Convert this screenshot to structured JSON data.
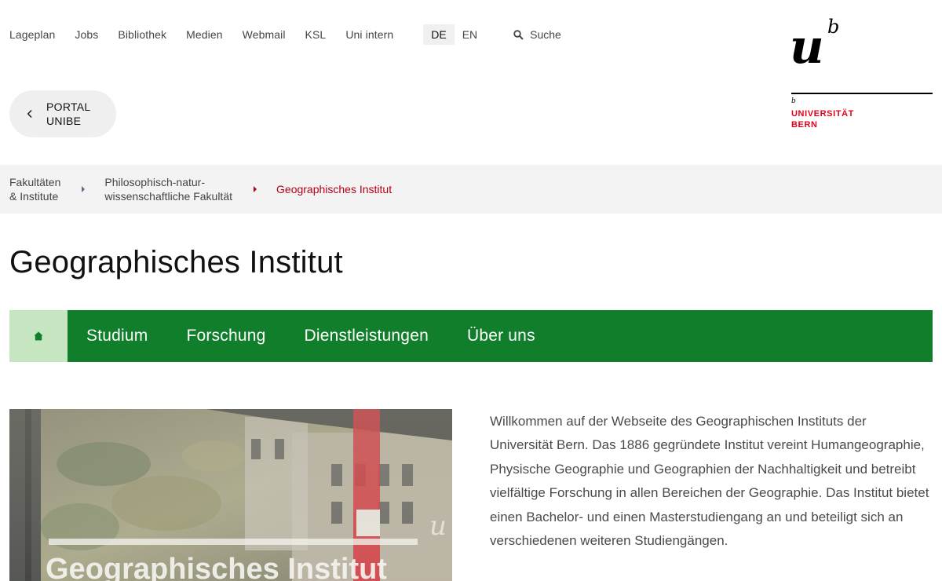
{
  "top_nav": {
    "links": [
      "Lageplan",
      "Jobs",
      "Bibliothek",
      "Medien",
      "Webmail",
      "KSL",
      "Uni intern"
    ],
    "languages": [
      "DE",
      "EN"
    ],
    "active_language": "DE",
    "search_label": "Suche"
  },
  "logo": {
    "mark_u": "u",
    "mark_b": "b",
    "small_b": "b",
    "line1": "UNIVERSITÄT",
    "line2": "BERN",
    "color": "#e2001a"
  },
  "portal_button": {
    "line1": "PORTAL",
    "line2": "UNIBE"
  },
  "breadcrumb": {
    "items": [
      {
        "line1": "Fakultäten",
        "line2": "& Institute"
      },
      {
        "line1": "Philosophisch-natur-",
        "line2": "wissenschaftliche Fakultät"
      }
    ],
    "current": "Geographisches Institut",
    "current_color": "#b3001a"
  },
  "page_title": "Geographisches Institut",
  "main_nav": {
    "home_icon": "home-icon",
    "items": [
      "Studium",
      "Forschung",
      "Dienstleistungen",
      "Über uns"
    ],
    "background": "#107e2a",
    "home_background": "#c6e5c1"
  },
  "hero_image": {
    "sign_text": "Geographisches Institut",
    "sign_letter": "u"
  },
  "intro": {
    "text": "Willkommen auf der Webseite des Geographischen Instituts der Universität Bern. Das 1886 gegründete Institut vereint Humangeographie, Physische Geographie und Geographien der Nachhaltigkeit und betreibt vielfältige Forschung in allen Bereichen der Geographie. Das Institut bietet einen Bachelor- und einen Masterstudiengang an und beteiligt sich an verschiedenen weiteren Studiengängen."
  }
}
